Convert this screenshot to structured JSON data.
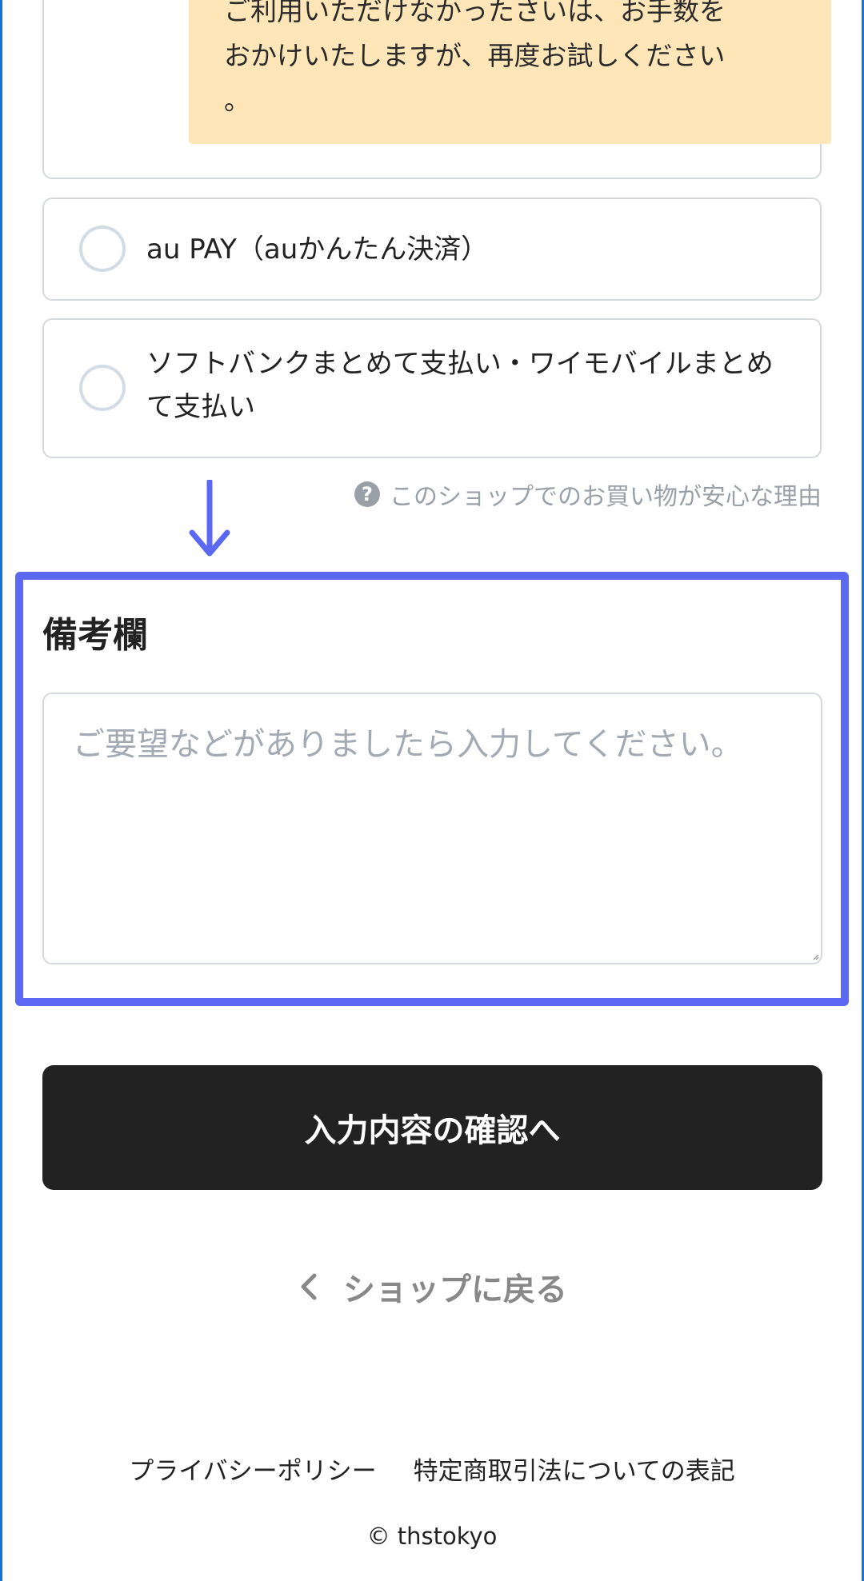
{
  "payment": {
    "notice_text": "ご利用いただけなかったさいは、お手数を\nおかけいたしますが、再度お試しください\n。",
    "options": [
      {
        "label": "au PAY（auかんたん決済）"
      },
      {
        "label": "ソフトバンクまとめて支払い・ワイモバイルまとめて支払い"
      }
    ],
    "reassurance_link": "このショップでのお買い物が安心な理由",
    "help_icon_glyph": "?"
  },
  "remarks": {
    "title": "備考欄",
    "placeholder": "ご要望などがありましたら入力してください。"
  },
  "confirm_button": "入力内容の確認へ",
  "back_link": "ショップに戻る",
  "footer": {
    "privacy": "プライバシーポリシー",
    "legal": "特定商取引法についての表記",
    "copyright": "© thstokyo"
  },
  "colors": {
    "highlight": "#5b68f2",
    "notice_bg": "#ffe6b8",
    "button_bg": "#222222",
    "muted_text": "#9aa0a8"
  }
}
